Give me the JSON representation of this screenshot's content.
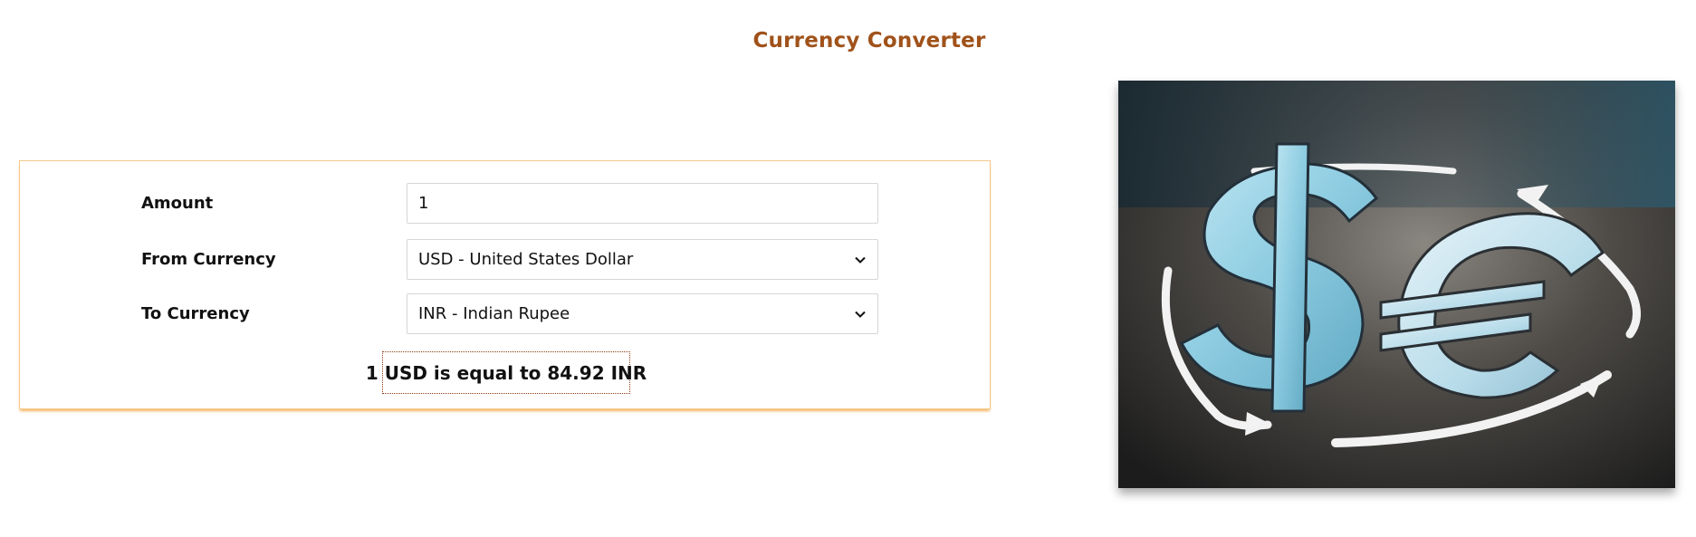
{
  "header": {
    "title": "Currency Converter"
  },
  "form": {
    "amount_label": "Amount",
    "amount_value": "1",
    "from_label": "From Currency",
    "from_selected": "USD - United States Dollar",
    "to_label": "To Currency",
    "to_selected": "INR - Indian Rupee",
    "result_text": "1 USD is equal to 84.92 INR"
  },
  "theme": {
    "title_color": "#a0521a",
    "box_border_color": "#f5c88a",
    "result_border_color": "#8a3a10"
  },
  "illustration": {
    "icon": "dollar-euro-exchange-icon"
  }
}
